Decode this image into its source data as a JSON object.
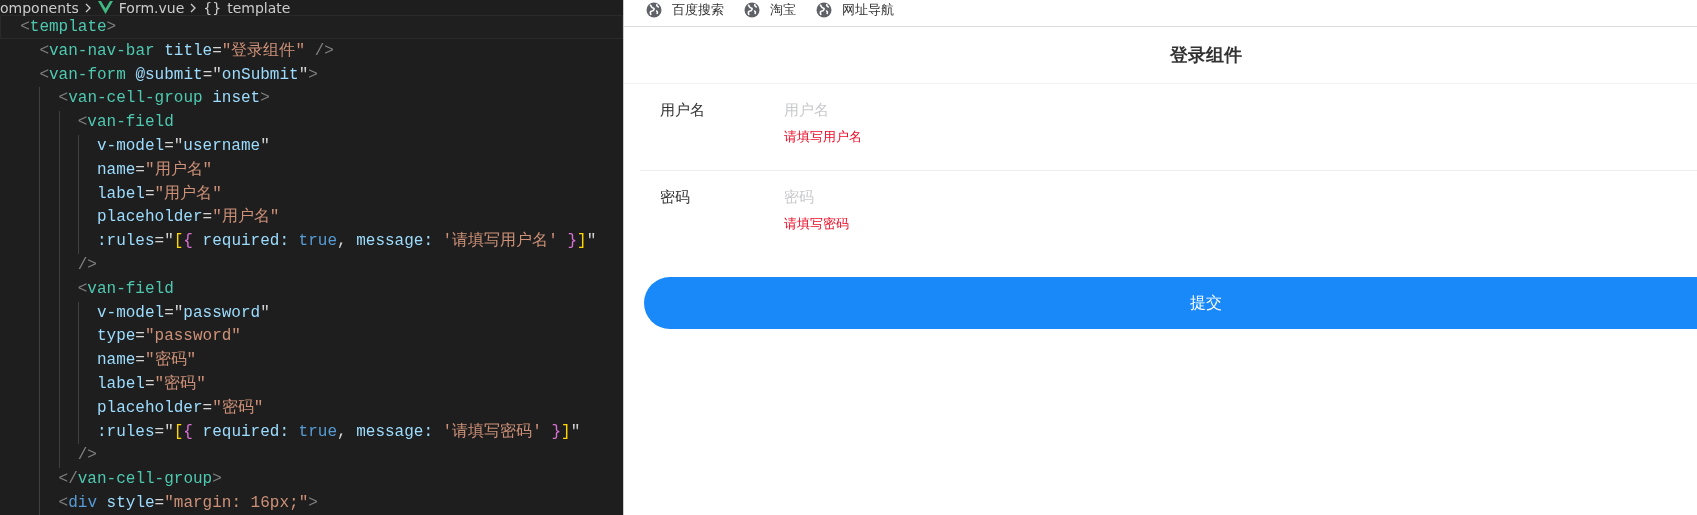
{
  "editor": {
    "breadcrumb": [
      {
        "kind": "folder",
        "text": "omponents"
      },
      {
        "kind": "vue",
        "text": "Form.vue"
      },
      {
        "kind": "symbol",
        "icon_text": "{}",
        "text": "template"
      }
    ],
    "lines": [
      {
        "current": true,
        "tokens": [
          {
            "kind": "punc",
            "text": "<"
          },
          {
            "kind": "tag",
            "text": "template"
          },
          {
            "kind": "punc",
            "text": ">"
          }
        ],
        "children": [
          {
            "current": false,
            "tokens": [
              {
                "kind": "punc",
                "text": "<"
              },
              {
                "kind": "tag",
                "text": "van-nav-bar "
              },
              {
                "kind": "attr",
                "text": "title"
              },
              {
                "kind": "plain",
                "text": "="
              },
              {
                "kind": "str",
                "text": "\"登录组件\" "
              },
              {
                "kind": "punc",
                "text": "/>"
              }
            ]
          },
          {
            "current": false,
            "tokens": [
              {
                "kind": "punc",
                "text": "<"
              },
              {
                "kind": "tag",
                "text": "van-form "
              },
              {
                "kind": "attr",
                "text": "@submit"
              },
              {
                "kind": "plain",
                "text": "=\""
              },
              {
                "kind": "attr",
                "text": "onSubmit"
              },
              {
                "kind": "plain",
                "text": "\""
              },
              {
                "kind": "punc",
                "text": ">"
              }
            ],
            "children": [
              {
                "current": false,
                "tokens": [
                  {
                    "kind": "punc",
                    "text": "<"
                  },
                  {
                    "kind": "tag",
                    "text": "van-cell-group "
                  },
                  {
                    "kind": "attr",
                    "text": "inset"
                  },
                  {
                    "kind": "punc",
                    "text": ">"
                  }
                ],
                "children": [
                  {
                    "current": false,
                    "tokens": [
                      {
                        "kind": "punc",
                        "text": "<"
                      },
                      {
                        "kind": "tag",
                        "text": "van-field"
                      }
                    ],
                    "children": [
                      {
                        "current": false,
                        "tokens": [
                          {
                            "kind": "attr",
                            "text": "v-model"
                          },
                          {
                            "kind": "plain",
                            "text": "=\""
                          },
                          {
                            "kind": "attr",
                            "text": "username"
                          },
                          {
                            "kind": "plain",
                            "text": "\""
                          }
                        ]
                      },
                      {
                        "current": false,
                        "tokens": [
                          {
                            "kind": "attr",
                            "text": "name"
                          },
                          {
                            "kind": "plain",
                            "text": "="
                          },
                          {
                            "kind": "str",
                            "text": "\"用户名\""
                          }
                        ]
                      },
                      {
                        "current": false,
                        "tokens": [
                          {
                            "kind": "attr",
                            "text": "label"
                          },
                          {
                            "kind": "plain",
                            "text": "="
                          },
                          {
                            "kind": "str",
                            "text": "\"用户名\""
                          }
                        ]
                      },
                      {
                        "current": false,
                        "tokens": [
                          {
                            "kind": "attr",
                            "text": "placeholder"
                          },
                          {
                            "kind": "plain",
                            "text": "="
                          },
                          {
                            "kind": "str",
                            "text": "\"用户名\""
                          }
                        ]
                      },
                      {
                        "current": false,
                        "tokens": [
                          {
                            "kind": "attr",
                            "text": ":rules"
                          },
                          {
                            "kind": "plain",
                            "text": "=\""
                          },
                          {
                            "kind": "brace1",
                            "text": "["
                          },
                          {
                            "kind": "brace2",
                            "text": "{"
                          },
                          {
                            "kind": "attr",
                            "text": " required:"
                          },
                          {
                            "kind": "const",
                            "text": " true"
                          },
                          {
                            "kind": "plain",
                            "text": ", "
                          },
                          {
                            "kind": "attr",
                            "text": "message:"
                          },
                          {
                            "kind": "str",
                            "text": " '请填写用户名' "
                          },
                          {
                            "kind": "brace2",
                            "text": "}"
                          },
                          {
                            "kind": "brace1",
                            "text": "]"
                          },
                          {
                            "kind": "plain",
                            "text": "\""
                          }
                        ]
                      }
                    ]
                  },
                  {
                    "current": false,
                    "tokens": [
                      {
                        "kind": "punc",
                        "text": "/>"
                      }
                    ]
                  },
                  {
                    "current": false,
                    "tokens": [
                      {
                        "kind": "punc",
                        "text": "<"
                      },
                      {
                        "kind": "tag",
                        "text": "van-field"
                      }
                    ],
                    "children": [
                      {
                        "current": false,
                        "tokens": [
                          {
                            "kind": "attr",
                            "text": "v-model"
                          },
                          {
                            "kind": "plain",
                            "text": "=\""
                          },
                          {
                            "kind": "attr",
                            "text": "password"
                          },
                          {
                            "kind": "plain",
                            "text": "\""
                          }
                        ]
                      },
                      {
                        "current": false,
                        "tokens": [
                          {
                            "kind": "attr",
                            "text": "type"
                          },
                          {
                            "kind": "plain",
                            "text": "="
                          },
                          {
                            "kind": "str",
                            "text": "\"password\""
                          }
                        ]
                      },
                      {
                        "current": false,
                        "tokens": [
                          {
                            "kind": "attr",
                            "text": "name"
                          },
                          {
                            "kind": "plain",
                            "text": "="
                          },
                          {
                            "kind": "str",
                            "text": "\"密码\""
                          }
                        ]
                      },
                      {
                        "current": false,
                        "tokens": [
                          {
                            "kind": "attr",
                            "text": "label"
                          },
                          {
                            "kind": "plain",
                            "text": "="
                          },
                          {
                            "kind": "str",
                            "text": "\"密码\""
                          }
                        ]
                      },
                      {
                        "current": false,
                        "tokens": [
                          {
                            "kind": "attr",
                            "text": "placeholder"
                          },
                          {
                            "kind": "plain",
                            "text": "="
                          },
                          {
                            "kind": "str",
                            "text": "\"密码\""
                          }
                        ]
                      },
                      {
                        "current": false,
                        "tokens": [
                          {
                            "kind": "attr",
                            "text": ":rules"
                          },
                          {
                            "kind": "plain",
                            "text": "=\""
                          },
                          {
                            "kind": "brace1",
                            "text": "["
                          },
                          {
                            "kind": "brace2",
                            "text": "{"
                          },
                          {
                            "kind": "attr",
                            "text": " required:"
                          },
                          {
                            "kind": "const",
                            "text": " true"
                          },
                          {
                            "kind": "plain",
                            "text": ", "
                          },
                          {
                            "kind": "attr",
                            "text": "message:"
                          },
                          {
                            "kind": "str",
                            "text": " '请填写密码' "
                          },
                          {
                            "kind": "brace2",
                            "text": "}"
                          },
                          {
                            "kind": "brace1",
                            "text": "]"
                          },
                          {
                            "kind": "plain",
                            "text": "\""
                          }
                        ]
                      }
                    ]
                  },
                  {
                    "current": false,
                    "tokens": [
                      {
                        "kind": "punc",
                        "text": "/>"
                      }
                    ]
                  }
                ]
              },
              {
                "current": false,
                "tokens": [
                  {
                    "kind": "punc",
                    "text": "</"
                  },
                  {
                    "kind": "tag",
                    "text": "van-cell-group"
                  },
                  {
                    "kind": "punc",
                    "text": ">"
                  }
                ]
              },
              {
                "current": false,
                "tokens": [
                  {
                    "kind": "punc",
                    "text": "<"
                  },
                  {
                    "kind": "tag2",
                    "text": "div "
                  },
                  {
                    "kind": "attr",
                    "text": "style"
                  },
                  {
                    "kind": "plain",
                    "text": "="
                  },
                  {
                    "kind": "str",
                    "text": "\"margin: 16px;\""
                  },
                  {
                    "kind": "punc",
                    "text": ">"
                  }
                ]
              }
            ]
          }
        ]
      }
    ]
  },
  "browser": {
    "bookmarks": [
      {
        "label": "百度搜索"
      },
      {
        "label": "淘宝"
      },
      {
        "label": "网址导航"
      }
    ],
    "nav_bar": {
      "title": "登录组件"
    },
    "fields": [
      {
        "label": "用户名",
        "placeholder": "用户名",
        "error": "请填写用户名"
      },
      {
        "label": "密码",
        "placeholder": "密码",
        "error": "请填写密码"
      }
    ],
    "submit_button": {
      "label": "提交"
    }
  }
}
